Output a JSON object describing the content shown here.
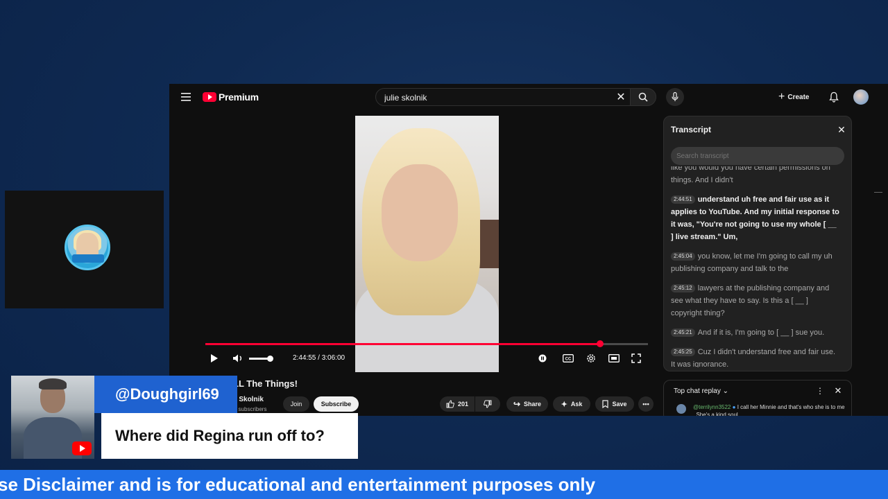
{
  "colors": {
    "brand_red": "#ff0033",
    "lower_third_blue": "#1f62d0",
    "ticker_blue": "#1f6fe6",
    "background_navy": "#0f2a52"
  },
  "youtube": {
    "logo_text": "Premium",
    "search": {
      "value": "julie skolnik"
    },
    "create_label": "Create",
    "player": {
      "time": "2:44:55 / 3:06:00",
      "progress_fraction": 0.892,
      "volume_fraction": 0.85
    },
    "video": {
      "title": "LL The Things!",
      "channel": "e Skolnik",
      "subscribers": "K subscribers",
      "join_label": "Join",
      "subscribe_label": "Subscribe",
      "like_count": "201",
      "share_label": "Share",
      "ask_label": "Ask",
      "save_label": "Save"
    },
    "transcript": {
      "title": "Transcript",
      "search_placeholder": "Search transcript",
      "segments": [
        {
          "time": "",
          "text": "like you would you have certain permissions on things. And I didn't"
        },
        {
          "time": "2:44:51",
          "text": "understand uh free and fair use as it applies to YouTube. And my initial response to it was, \"You're not going to use my whole [ __ ] live stream.\" Um,"
        },
        {
          "time": "2:45:04",
          "text": "you know, let me I'm going to call my uh publishing company and talk to the"
        },
        {
          "time": "2:45:12",
          "text": "lawyers at the publishing company and see what they have to say. Is this a [ __ ] copyright thing?"
        },
        {
          "time": "2:45:21",
          "text": "And if it is, I'm going to [ __ ] sue you."
        },
        {
          "time": "2:45:25",
          "text": "Cuz I didn't understand free and fair use. It was ignorance."
        }
      ]
    },
    "chat": {
      "header": "Top chat replay",
      "author": "@terrilynn3522",
      "message": "I call her Minnie and that's who she is to me . She's a kind soul"
    }
  },
  "stream_overlay": {
    "username": "@Doughgirl69",
    "question": "Where did Regina run off to?",
    "ticker": "se Disclaimer and is for educational and entertainment purposes only"
  }
}
